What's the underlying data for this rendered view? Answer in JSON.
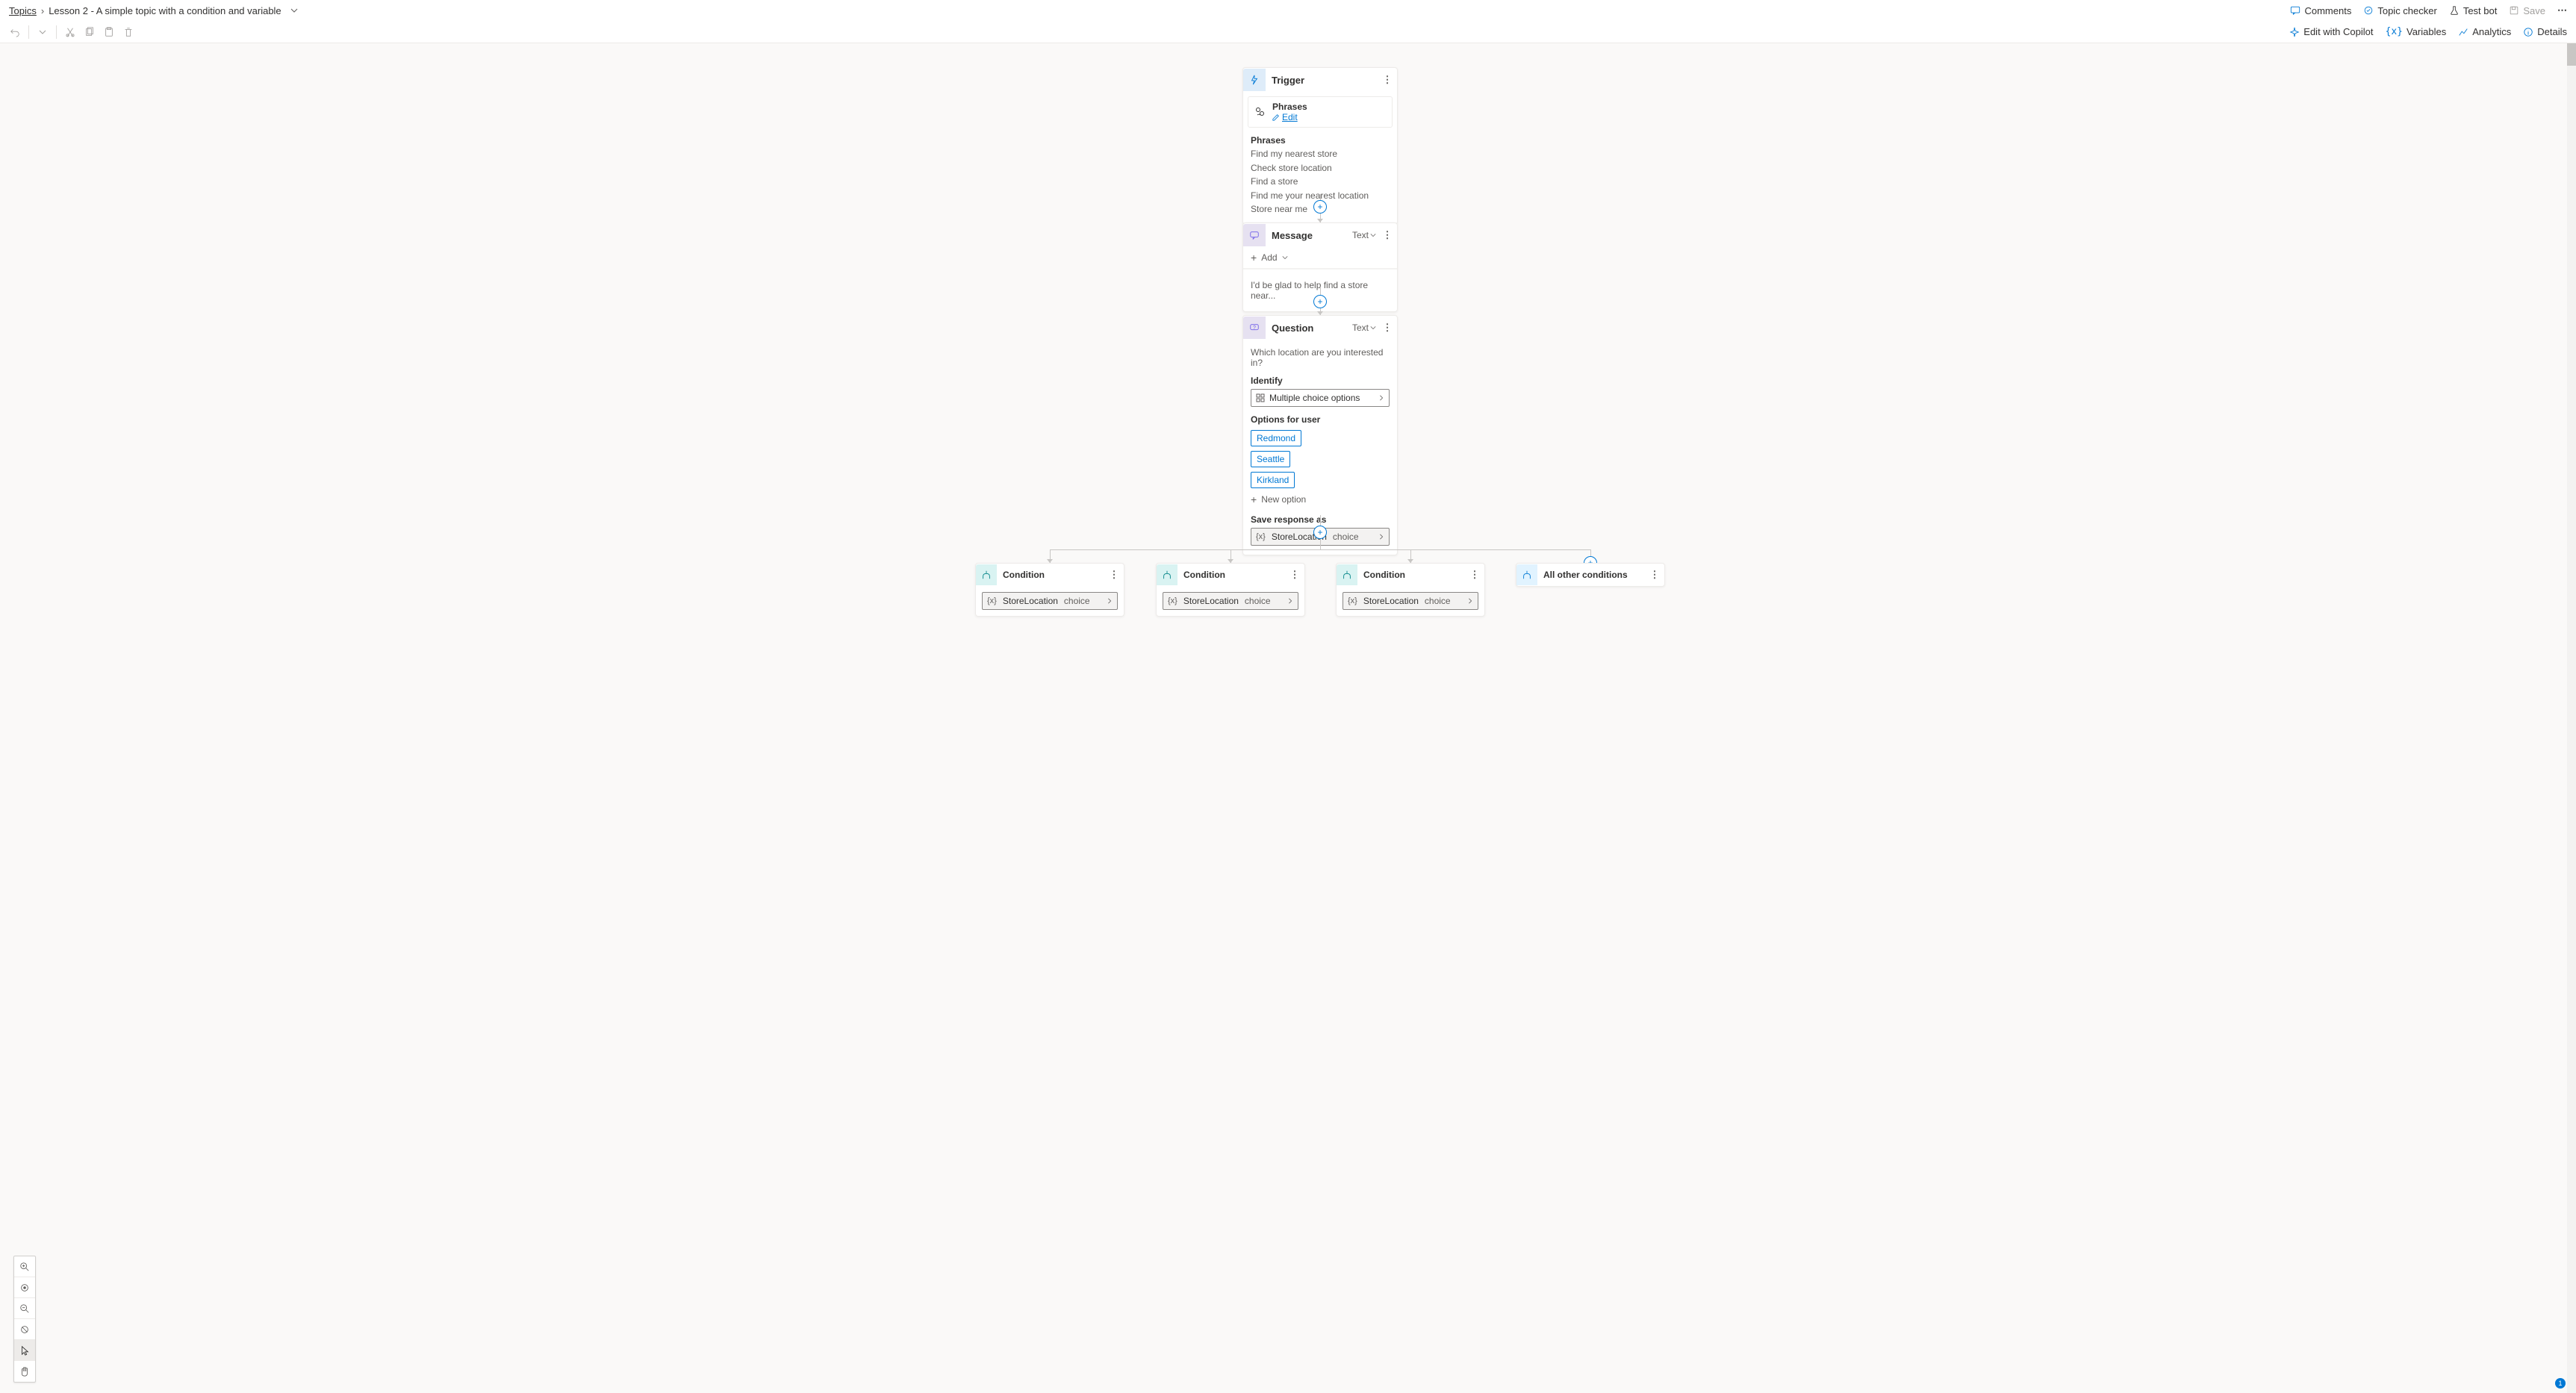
{
  "breadcrumb": {
    "root": "Topics",
    "title": "Lesson 2 - A simple topic with a condition and variable"
  },
  "top_actions": {
    "comments": "Comments",
    "topic_checker": "Topic checker",
    "test_bot": "Test bot",
    "save": "Save"
  },
  "toolbar": {
    "edit_copilot": "Edit with Copilot",
    "variables": "Variables",
    "analytics": "Analytics",
    "details": "Details"
  },
  "zoom_tools": {
    "zoom_in": "zoom-in",
    "fit": "fit",
    "zoom_out": "zoom-out",
    "reset": "reset",
    "select": "select",
    "hand": "hand"
  },
  "trigger": {
    "title": "Trigger",
    "phrases_label": "Phrases",
    "edit": "Edit",
    "section": "Phrases",
    "lines": [
      "Find my nearest store",
      "Check store location",
      "Find a store",
      "Find me your nearest location",
      "Store near me"
    ]
  },
  "message": {
    "title": "Message",
    "type": "Text",
    "add": "Add",
    "body": "I'd be glad to help find a store near..."
  },
  "question": {
    "title": "Question",
    "type": "Text",
    "prompt": "Which location are you interested in?",
    "identify_label": "Identify",
    "identify_value": "Multiple choice options",
    "options_label": "Options for user",
    "options": [
      "Redmond",
      "Seattle",
      "Kirkland"
    ],
    "new_option": "New option",
    "save_as_label": "Save response as",
    "variable_name": "StoreLocation",
    "variable_type": "choice"
  },
  "conditions": [
    {
      "title": "Condition",
      "variable": "StoreLocation",
      "type": "choice"
    },
    {
      "title": "Condition",
      "variable": "StoreLocation",
      "type": "choice"
    },
    {
      "title": "Condition",
      "variable": "StoreLocation",
      "type": "choice"
    },
    {
      "title": "All other conditions"
    }
  ],
  "colors": {
    "accent": "#0078d4",
    "purple": "#7160e8",
    "teal": "#038387"
  }
}
